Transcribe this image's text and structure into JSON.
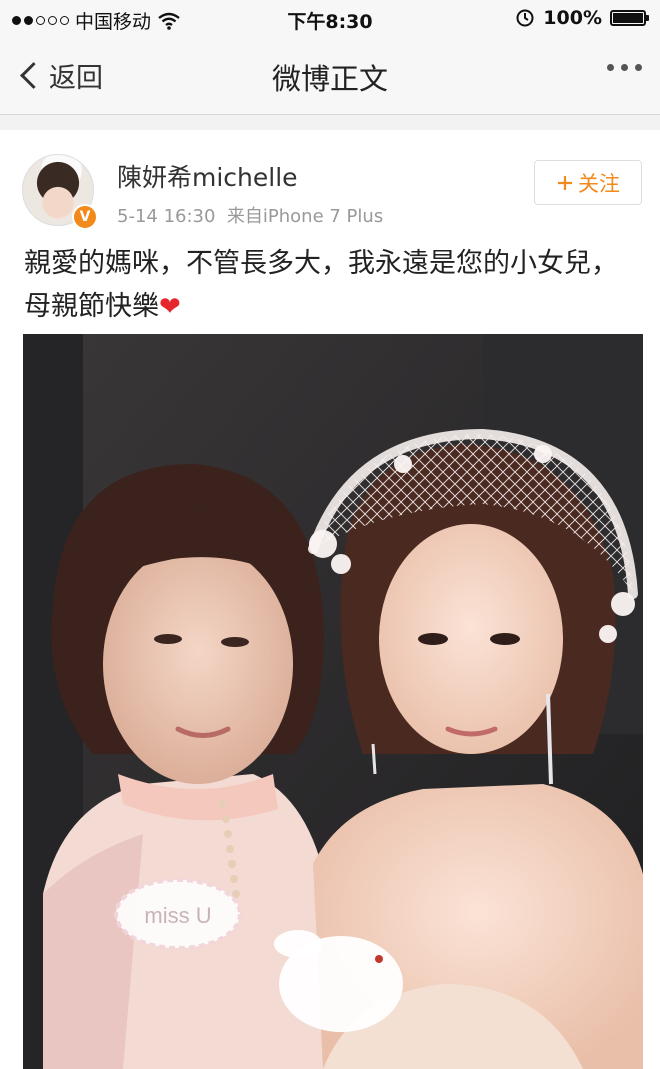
{
  "status_bar": {
    "carrier": "中国移动",
    "time": "下午8:30",
    "battery": "100%"
  },
  "nav": {
    "back_label": "返回",
    "title": "微博正文"
  },
  "post": {
    "username": "陳妍希michelle",
    "verified_badge": "V",
    "timestamp": "5-14 16:30",
    "source": "来自iPhone 7 Plus",
    "follow_label": "关注",
    "text": "親愛的媽咪，不管長多大，我永遠是您的小女兒，母親節快樂",
    "emoji": "❤",
    "photo_sticker_text": "miss U"
  },
  "colors": {
    "accent": "#f28a1b",
    "heart": "#e5262d"
  },
  "icons": [
    "wifi-icon",
    "alarm-icon",
    "battery-icon",
    "back-chevron-icon",
    "more-icon",
    "verified-icon",
    "plus-icon",
    "heart-emoji-icon"
  ]
}
